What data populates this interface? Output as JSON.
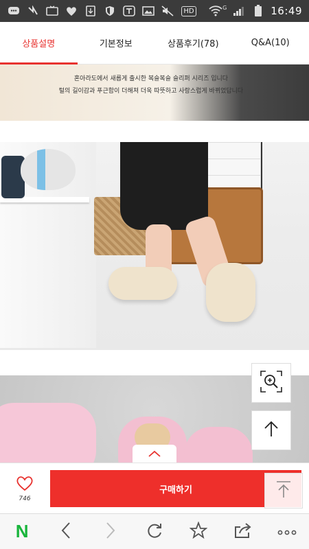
{
  "status_bar": {
    "time": "16:49",
    "network": "G",
    "icons": [
      "message-icon",
      "no-signal-icon",
      "tv-icon",
      "heart-icon",
      "download-icon",
      "shield-icon",
      "t-icon",
      "image-icon",
      "mute-icon",
      "hd-icon",
      "wifi-icon",
      "signal-icon",
      "battery-icon"
    ],
    "hd_label": "HD"
  },
  "tabs": [
    {
      "label": "상품설명",
      "active": true
    },
    {
      "label": "기본정보",
      "active": false
    },
    {
      "label": "상품후기(78)",
      "active": false
    },
    {
      "label": "Q&A(10)",
      "active": false
    }
  ],
  "content": {
    "caption_line1": "혼아라도에서 새롭게 출시한 복슬복슬 슬리퍼 시리즈 입니다",
    "caption_line2": "털의 길이감과 푸근함이 더해져 더욱 따뜻하고 사랑스럽게 바뀌었답니다"
  },
  "buy_bar": {
    "like_count": "746",
    "buy_label": "구매하기"
  },
  "colors": {
    "accent": "#e8322f",
    "buy_button": "#ee2f2b",
    "naver_green": "#19b53c"
  },
  "browser_nav": {
    "logo": "N",
    "items": [
      "naver-logo",
      "back-icon",
      "forward-icon",
      "refresh-icon",
      "bookmark-star-icon",
      "share-icon",
      "more-icon"
    ]
  }
}
